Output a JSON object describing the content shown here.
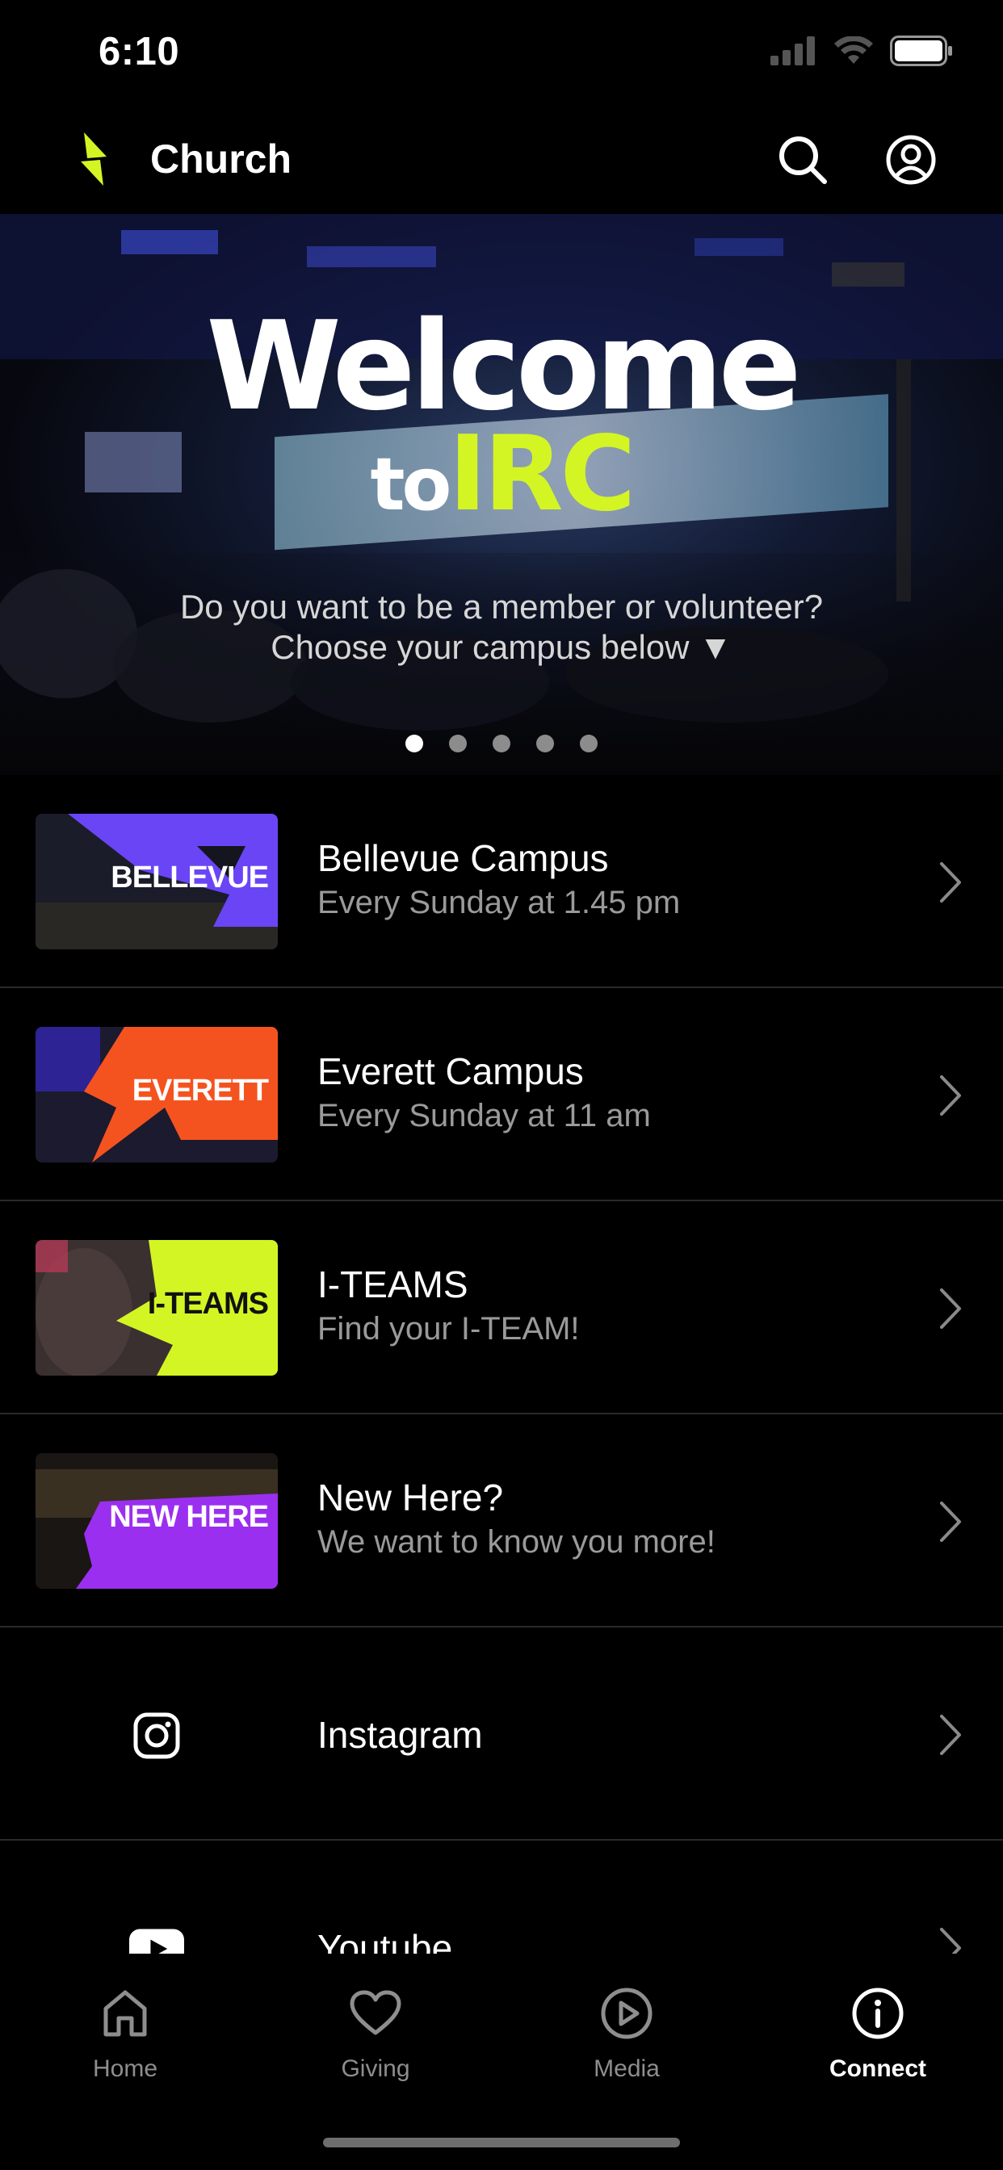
{
  "status_bar": {
    "time": "6:10"
  },
  "header": {
    "title": "Church",
    "accent_color": "#d4f524"
  },
  "hero": {
    "title_line1": "Welcome",
    "title_to": "to",
    "title_irc": "IRC",
    "subtitle_line1": "Do you want to be a member or volunteer?",
    "subtitle_line2": "Choose your campus below ▼",
    "slides": 5,
    "active_slide": 1
  },
  "list": {
    "items": [
      {
        "title": "Bellevue Campus",
        "subtitle": "Every Sunday at 1.45 pm",
        "thumb_label": "BELLEVUE",
        "thumb_color": "#6a45f5"
      },
      {
        "title": "Everett Campus",
        "subtitle": "Every Sunday at 11 am",
        "thumb_label": "EVERETT",
        "thumb_color": "#f4531f"
      },
      {
        "title": "I-TEAMS",
        "subtitle": "Find your I-TEAM!",
        "thumb_label": "I-TEAMS",
        "thumb_color": "#d4f524"
      },
      {
        "title": "New Here?",
        "subtitle": "We want to know you more!",
        "thumb_label": "NEW HERE",
        "thumb_color": "#9b2ff0"
      },
      {
        "title": "Instagram",
        "icon": "instagram-icon"
      },
      {
        "title": "Youtube",
        "icon": "youtube-icon"
      }
    ]
  },
  "tabs": [
    {
      "label": "Home",
      "icon": "home-icon",
      "active": false
    },
    {
      "label": "Giving",
      "icon": "heart-icon",
      "active": false
    },
    {
      "label": "Media",
      "icon": "play-circle-icon",
      "active": false
    },
    {
      "label": "Connect",
      "icon": "info-circle-icon",
      "active": true
    }
  ]
}
